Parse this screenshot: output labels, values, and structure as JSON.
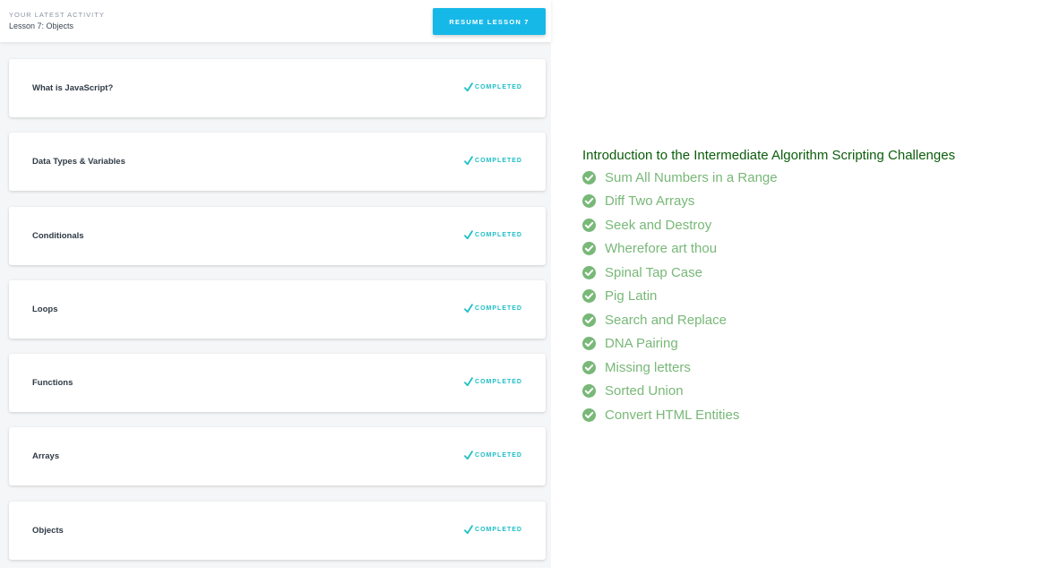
{
  "activity": {
    "kicker": "YOUR LATEST ACTIVITY",
    "lesson": "Lesson 7: Objects",
    "resume_label": "RESUME LESSON 7",
    "accent": "#16b8e8"
  },
  "lessons": [
    {
      "title": "What is JavaScript?",
      "status": "COMPLETED",
      "icon": "check-icon"
    },
    {
      "title": "Data Types & Variables",
      "status": "COMPLETED",
      "icon": "check-icon"
    },
    {
      "title": "Conditionals",
      "status": "COMPLETED",
      "icon": "check-icon"
    },
    {
      "title": "Loops",
      "status": "COMPLETED",
      "icon": "check-icon"
    },
    {
      "title": "Functions",
      "status": "COMPLETED",
      "icon": "check-icon"
    },
    {
      "title": "Arrays",
      "status": "COMPLETED",
      "icon": "check-icon"
    },
    {
      "title": "Objects",
      "status": "COMPLETED",
      "icon": "check-icon"
    }
  ],
  "colors": {
    "completed": "#1dbfc6",
    "section_title": "#0b5d0b",
    "challenge": "#78b878"
  },
  "challenges": {
    "title": "Introduction to the Intermediate Algorithm Scripting Challenges",
    "items": [
      {
        "label": "Sum All Numbers in a Range",
        "icon": "circle-check-icon"
      },
      {
        "label": "Diff Two Arrays",
        "icon": "circle-check-icon"
      },
      {
        "label": "Seek and Destroy",
        "icon": "circle-check-icon"
      },
      {
        "label": "Wherefore art thou",
        "icon": "circle-check-icon"
      },
      {
        "label": "Spinal Tap Case",
        "icon": "circle-check-icon"
      },
      {
        "label": "Pig Latin",
        "icon": "circle-check-icon"
      },
      {
        "label": "Search and Replace",
        "icon": "circle-check-icon"
      },
      {
        "label": "DNA Pairing",
        "icon": "circle-check-icon"
      },
      {
        "label": "Missing letters",
        "icon": "circle-check-icon"
      },
      {
        "label": "Sorted Union",
        "icon": "circle-check-icon"
      },
      {
        "label": "Convert HTML Entities",
        "icon": "circle-check-icon"
      }
    ]
  }
}
